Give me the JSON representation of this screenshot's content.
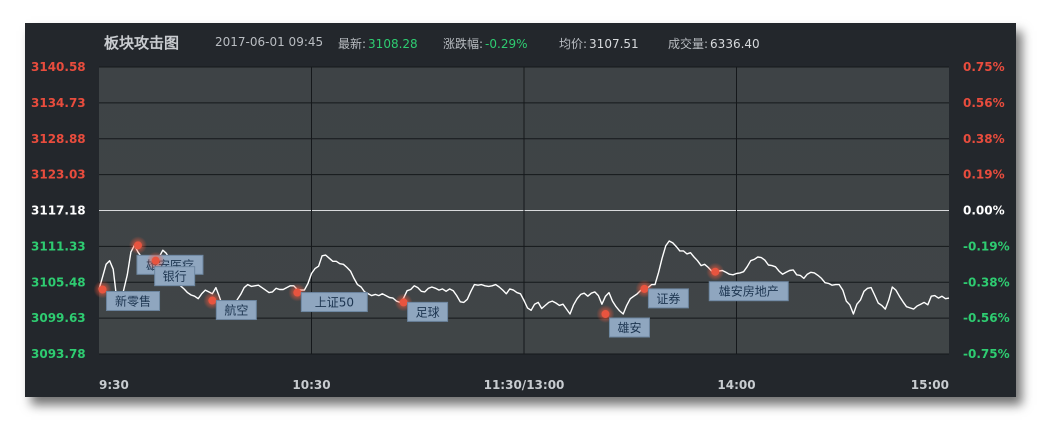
{
  "header": {
    "title": "板块攻击图",
    "datetime": "2017-06-01 09:45",
    "latest_label": "最新:",
    "latest_value": "3108.28",
    "change_label": "涨跌幅:",
    "change_value": "-0.29%",
    "avg_label": "均价:",
    "avg_value": "3107.51",
    "volume_label": "成交量:",
    "volume_value": "6336.40"
  },
  "colors": {
    "up": "#e84c3d",
    "down": "#2ecc71",
    "neutral": "#ffffff",
    "line": "#ffffff",
    "marker": "#e8543f",
    "label_bg": "#8fa6bf",
    "label_text": "#1d3550"
  },
  "chart_data": {
    "type": "line",
    "base": 3117.18,
    "ylim": [
      3093.78,
      3140.58
    ],
    "yticks_left": [
      "3140.58",
      "3134.73",
      "3128.88",
      "3123.03",
      "3117.18",
      "3111.33",
      "3105.48",
      "3099.63",
      "3093.78"
    ],
    "yticks_right": [
      "0.75%",
      "0.56%",
      "0.38%",
      "0.19%",
      "0.00%",
      "-0.19%",
      "-0.38%",
      "-0.56%",
      "-0.75%"
    ],
    "xlabels": [
      "9:30",
      "10:30",
      "11:30/13:00",
      "14:00",
      "15:00"
    ],
    "x_unit": "trading minute (0 = 9:30, 240 = 15:00)",
    "series": [
      {
        "values": [
          [
            0,
            3104.3
          ],
          [
            1,
            3106.3
          ],
          [
            2,
            3108.4
          ],
          [
            3,
            3109.0
          ],
          [
            4,
            3107.6
          ],
          [
            5,
            3102.8
          ],
          [
            6,
            3101.9
          ],
          [
            7,
            3104.3
          ],
          [
            8,
            3106.7
          ],
          [
            9,
            3110.4
          ],
          [
            10,
            3111.5
          ],
          [
            11,
            3110.4
          ],
          [
            12,
            3109.6
          ],
          [
            13,
            3108.9
          ],
          [
            14,
            3108.5
          ],
          [
            15,
            3107.6
          ],
          [
            16,
            3108.6
          ],
          [
            17,
            3109.6
          ],
          [
            18,
            3110.7
          ],
          [
            19,
            3110.2
          ],
          [
            20,
            3109.2
          ],
          [
            21,
            3107.5
          ],
          [
            22,
            3106.1
          ],
          [
            23,
            3104.9
          ],
          [
            24,
            3104.4
          ],
          [
            25,
            3103.8
          ],
          [
            26,
            3103.4
          ],
          [
            27,
            3103.2
          ],
          [
            28,
            3102.8
          ],
          [
            29,
            3103.6
          ],
          [
            30,
            3104.2
          ],
          [
            31,
            3103.9
          ],
          [
            32,
            3103.6
          ],
          [
            33,
            3104.6
          ],
          [
            34,
            3103.1
          ],
          [
            35,
            3101.4
          ],
          [
            36,
            3100.9
          ],
          [
            37,
            3101.3
          ],
          [
            38,
            3100.3
          ],
          [
            39,
            3102.6
          ],
          [
            40,
            3103.5
          ],
          [
            41,
            3104.6
          ],
          [
            42,
            3105.1
          ],
          [
            43,
            3104.8
          ],
          [
            44,
            3104.9
          ],
          [
            45,
            3105.0
          ],
          [
            46,
            3104.6
          ],
          [
            47,
            3104.2
          ],
          [
            48,
            3103.8
          ],
          [
            49,
            3103.9
          ],
          [
            50,
            3104.5
          ],
          [
            51,
            3104.3
          ],
          [
            52,
            3104.3
          ],
          [
            53,
            3104.6
          ],
          [
            54,
            3104.9
          ],
          [
            55,
            3104.9
          ],
          [
            56,
            3104.3
          ],
          [
            57,
            3104.2
          ],
          [
            58,
            3104.2
          ],
          [
            59,
            3105.3
          ],
          [
            60,
            3106.9
          ],
          [
            61,
            3107.7
          ],
          [
            62,
            3108.1
          ],
          [
            63,
            3109.8
          ],
          [
            64,
            3109.9
          ],
          [
            65,
            3109.4
          ],
          [
            66,
            3108.9
          ],
          [
            67,
            3108.9
          ],
          [
            68,
            3108.5
          ],
          [
            69,
            3108.4
          ],
          [
            70,
            3107.9
          ],
          [
            71,
            3107.3
          ],
          [
            72,
            3106.1
          ],
          [
            73,
            3105.1
          ],
          [
            74,
            3104.7
          ],
          [
            75,
            3103.9
          ],
          [
            76,
            3103.6
          ],
          [
            77,
            3103.3
          ],
          [
            78,
            3103.5
          ],
          [
            79,
            3103.3
          ],
          [
            80,
            3103.6
          ],
          [
            81,
            3103.3
          ],
          [
            82,
            3103.0
          ],
          [
            83,
            3102.9
          ],
          [
            84,
            3102.4
          ],
          [
            85,
            3102.2
          ],
          [
            86,
            3102.9
          ],
          [
            87,
            3104.1
          ],
          [
            88,
            3104.3
          ],
          [
            89,
            3104.9
          ],
          [
            90,
            3104.6
          ],
          [
            91,
            3104.0
          ],
          [
            92,
            3103.9
          ],
          [
            93,
            3104.5
          ],
          [
            94,
            3104.7
          ],
          [
            95,
            3104.5
          ],
          [
            96,
            3104.2
          ],
          [
            97,
            3104.4
          ],
          [
            98,
            3104.0
          ],
          [
            99,
            3104.4
          ],
          [
            100,
            3104.1
          ],
          [
            101,
            3103.3
          ],
          [
            102,
            3102.3
          ],
          [
            103,
            3102.2
          ],
          [
            104,
            3102.7
          ],
          [
            105,
            3104.0
          ],
          [
            106,
            3105.1
          ],
          [
            107,
            3105.0
          ],
          [
            108,
            3105.1
          ],
          [
            109,
            3104.9
          ],
          [
            110,
            3104.8
          ],
          [
            111,
            3104.9
          ],
          [
            112,
            3105.1
          ],
          [
            113,
            3104.7
          ],
          [
            114,
            3104.2
          ],
          [
            115,
            3103.6
          ],
          [
            116,
            3104.4
          ],
          [
            117,
            3104.2
          ],
          [
            118,
            3103.8
          ],
          [
            119,
            3103.6
          ],
          [
            120,
            3102.5
          ],
          [
            121,
            3101.3
          ],
          [
            122,
            3100.9
          ],
          [
            123,
            3101.9
          ],
          [
            124,
            3102.2
          ],
          [
            125,
            3101.2
          ],
          [
            126,
            3101.7
          ],
          [
            127,
            3102.2
          ],
          [
            128,
            3102.4
          ],
          [
            129,
            3102.1
          ],
          [
            130,
            3101.7
          ],
          [
            131,
            3101.9
          ],
          [
            132,
            3101.1
          ],
          [
            133,
            3100.3
          ],
          [
            134,
            3101.8
          ],
          [
            135,
            3102.8
          ],
          [
            136,
            3103.5
          ],
          [
            137,
            3103.7
          ],
          [
            138,
            3103.2
          ],
          [
            139,
            3103.7
          ],
          [
            140,
            3103.9
          ],
          [
            141,
            3103.3
          ],
          [
            142,
            3101.9
          ],
          [
            143,
            3103.2
          ],
          [
            144,
            3103.8
          ],
          [
            145,
            3102.4
          ],
          [
            146,
            3101.5
          ],
          [
            147,
            3100.8
          ],
          [
            148,
            3100.3
          ],
          [
            149,
            3101.7
          ],
          [
            150,
            3102.8
          ],
          [
            151,
            3103.2
          ],
          [
            152,
            3103.6
          ],
          [
            153,
            3104.2
          ],
          [
            154,
            3104.4
          ],
          [
            155,
            3104.6
          ],
          [
            156,
            3105.1
          ],
          [
            157,
            3105.1
          ],
          [
            158,
            3107.1
          ],
          [
            159,
            3109.4
          ],
          [
            160,
            3111.4
          ],
          [
            161,
            3112.2
          ],
          [
            162,
            3111.9
          ],
          [
            163,
            3111.3
          ],
          [
            164,
            3110.6
          ],
          [
            165,
            3110.6
          ],
          [
            166,
            3110.1
          ],
          [
            167,
            3110.3
          ],
          [
            168,
            3109.6
          ],
          [
            169,
            3109.0
          ],
          [
            170,
            3108.2
          ],
          [
            171,
            3108.4
          ],
          [
            172,
            3107.9
          ],
          [
            173,
            3107.3
          ],
          [
            174,
            3107.2
          ],
          [
            175,
            3107.3
          ],
          [
            176,
            3107.4
          ],
          [
            177,
            3107.1
          ],
          [
            178,
            3106.8
          ],
          [
            179,
            3106.7
          ],
          [
            180,
            3106.9
          ],
          [
            181,
            3107.0
          ],
          [
            182,
            3107.2
          ],
          [
            183,
            3108.0
          ],
          [
            184,
            3109.0
          ],
          [
            185,
            3109.2
          ],
          [
            186,
            3109.6
          ],
          [
            187,
            3109.5
          ],
          [
            188,
            3109.1
          ],
          [
            189,
            3108.3
          ],
          [
            190,
            3108.2
          ],
          [
            191,
            3108.0
          ],
          [
            192,
            3107.3
          ],
          [
            193,
            3106.8
          ],
          [
            194,
            3107.1
          ],
          [
            195,
            3107.4
          ],
          [
            196,
            3107.5
          ],
          [
            197,
            3106.7
          ],
          [
            198,
            3106.6
          ],
          [
            199,
            3106.1
          ],
          [
            200,
            3106.8
          ],
          [
            201,
            3107.1
          ],
          [
            202,
            3107.0
          ],
          [
            203,
            3106.6
          ],
          [
            204,
            3106.1
          ],
          [
            205,
            3105.4
          ],
          [
            206,
            3105.3
          ],
          [
            207,
            3105.0
          ],
          [
            208,
            3105.1
          ],
          [
            209,
            3105.1
          ],
          [
            210,
            3104.2
          ],
          [
            211,
            3102.4
          ],
          [
            212,
            3101.8
          ],
          [
            213,
            3100.3
          ],
          [
            214,
            3101.9
          ],
          [
            215,
            3102.6
          ],
          [
            216,
            3104.0
          ],
          [
            217,
            3104.5
          ],
          [
            218,
            3104.6
          ],
          [
            219,
            3103.4
          ],
          [
            220,
            3102.1
          ],
          [
            221,
            3101.7
          ],
          [
            222,
            3101.1
          ],
          [
            223,
            3102.6
          ],
          [
            224,
            3104.7
          ],
          [
            225,
            3104.2
          ],
          [
            226,
            3103.2
          ],
          [
            227,
            3102.3
          ],
          [
            228,
            3101.5
          ],
          [
            229,
            3101.3
          ],
          [
            230,
            3101.1
          ],
          [
            231,
            3101.6
          ],
          [
            232,
            3101.9
          ],
          [
            233,
            3102.2
          ],
          [
            234,
            3101.8
          ],
          [
            235,
            3103.2
          ],
          [
            236,
            3103.3
          ],
          [
            237,
            3102.9
          ],
          [
            238,
            3103.2
          ],
          [
            239,
            3102.8
          ],
          [
            240,
            3102.9
          ]
        ]
      }
    ],
    "annotations": [
      {
        "label": "新零售",
        "x": 1,
        "y": 3104.3
      },
      {
        "label": "雄安医疗",
        "x": 11,
        "y": 3111.5
      },
      {
        "label": "银行",
        "x": 16,
        "y": 3109.0
      },
      {
        "label": "航空",
        "x": 32,
        "y": 3102.5
      },
      {
        "label": "上证50",
        "x": 56,
        "y": 3103.8
      },
      {
        "label": "足球",
        "x": 86,
        "y": 3102.2
      },
      {
        "label": "雄安",
        "x": 143,
        "y": 3100.3
      },
      {
        "label": "证券",
        "x": 154,
        "y": 3104.4
      },
      {
        "label": "雄安房地产",
        "x": 174,
        "y": 3107.2
      }
    ]
  }
}
